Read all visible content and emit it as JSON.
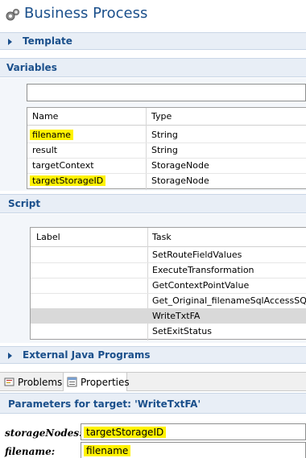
{
  "header": {
    "title": "Business Process",
    "icon": "gears-icon"
  },
  "sections": {
    "template": {
      "label": "Template"
    },
    "variables": {
      "label": "Variables"
    },
    "script": {
      "label": "Script"
    },
    "external": {
      "label": "External Java Programs"
    }
  },
  "variables_table": {
    "columns": [
      "Name",
      "Type"
    ],
    "rows": [
      {
        "name": "filename",
        "type": "String",
        "highlighted": true
      },
      {
        "name": "result",
        "type": "String",
        "highlighted": false
      },
      {
        "name": "targetContext",
        "type": "StorageNode",
        "highlighted": false
      },
      {
        "name": "targetStorageID",
        "type": "StorageNode",
        "highlighted": true
      }
    ]
  },
  "script_table": {
    "columns": [
      "Label",
      "Task"
    ],
    "rows": [
      {
        "label": "",
        "task": "SetRouteFieldValues"
      },
      {
        "label": "",
        "task": "ExecuteTransformation"
      },
      {
        "label": "",
        "task": "GetContextPointValue"
      },
      {
        "label": "",
        "task": "Get_Original_filenameSqlAccessSQL"
      },
      {
        "label": "",
        "task": "WriteTxtFA",
        "selected": true
      },
      {
        "label": "",
        "task": "SetExitStatus"
      }
    ]
  },
  "bottom_tabs": [
    {
      "label": "Problems",
      "icon": "problems-icon"
    },
    {
      "label": "Properties",
      "icon": "properties-icon",
      "active": true
    }
  ],
  "parameters": {
    "title": "Parameters for target: 'WriteTxtFA'",
    "fields": [
      {
        "label": "storageNodes:",
        "value": "targetStorageID"
      },
      {
        "label": "filename:",
        "value": "filename"
      }
    ]
  },
  "colors": {
    "accent": "#1a4f8b",
    "highlight": "#fff200",
    "section_bg": "#e8eef6",
    "selected_row": "#d9d9d9"
  }
}
